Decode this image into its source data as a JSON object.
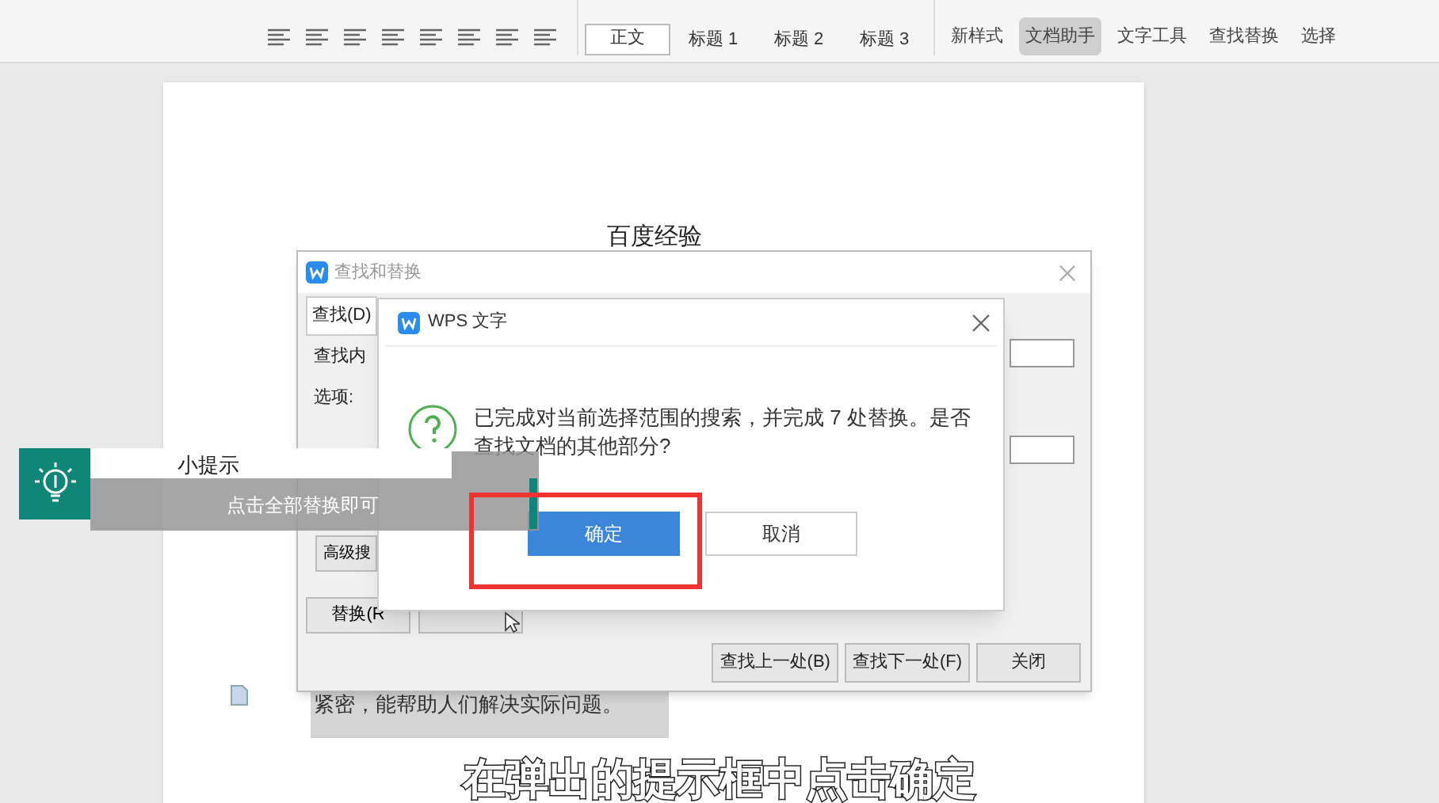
{
  "toolbar": {
    "styles": [
      {
        "label": "正文",
        "selected": true
      },
      {
        "label": "标题 1",
        "selected": false
      },
      {
        "label": "标题 2",
        "selected": false
      },
      {
        "label": "标题 3",
        "selected": false
      }
    ],
    "tools": [
      {
        "label": "新样式",
        "selected": false
      },
      {
        "label": "文档助手",
        "selected": true
      },
      {
        "label": "文字工具",
        "selected": false
      },
      {
        "label": "查找替换",
        "selected": false
      },
      {
        "label": "选择",
        "selected": false
      }
    ]
  },
  "document": {
    "title": "百度经验",
    "bottom_text": "紧密，能帮助人们解决实际问题。"
  },
  "find_dialog": {
    "title": "查找和替换",
    "tab": "查找(D)",
    "labels": [
      "查找内",
      "选项:"
    ],
    "advanced": "高级搜",
    "replace": "替换(R",
    "buttons": [
      "查找上一处(B)",
      "查找下一处(F)",
      "关闭"
    ]
  },
  "message_box": {
    "title": "WPS 文字",
    "message": "已完成对当前选择范围的搜索，并完成 7 处替换。是否查找文档的其他部分?",
    "buttons": [
      {
        "label": "确定",
        "primary": true
      },
      {
        "label": "取消",
        "primary": false
      }
    ]
  },
  "tip": {
    "title": "小提示",
    "text": "点击全部替换即可"
  },
  "caption": "在弹出的提示框中点击确定"
}
